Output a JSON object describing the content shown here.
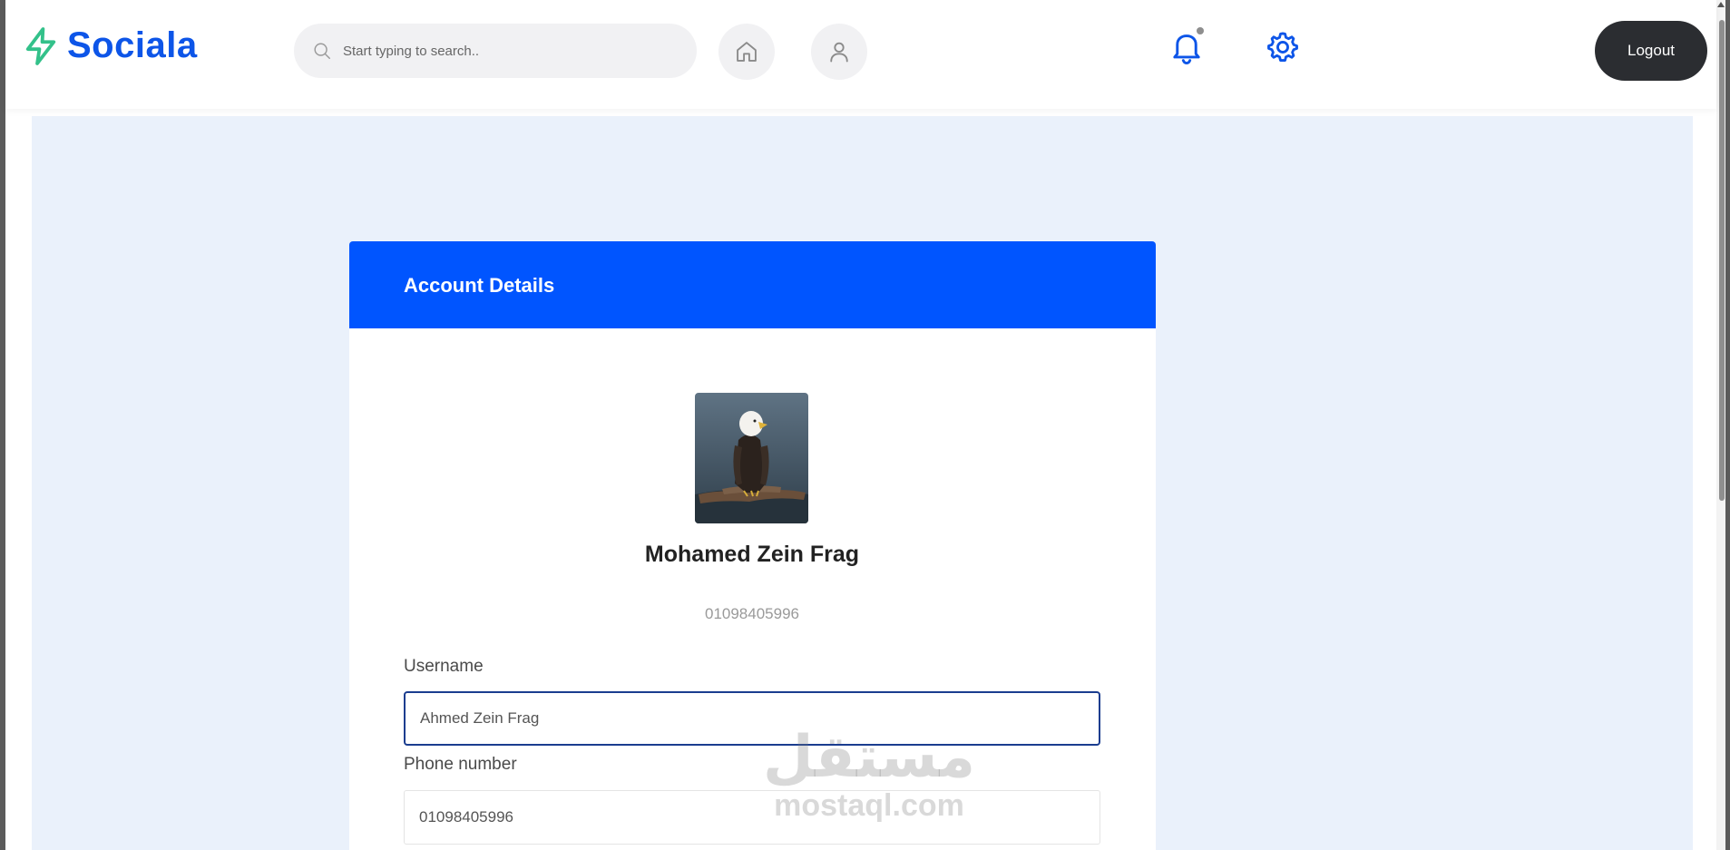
{
  "app": {
    "name": "Sociala",
    "brand_color": "#0d55e8",
    "accent_color": "#33c18a"
  },
  "header": {
    "search": {
      "placeholder": "Start typing to search.."
    },
    "icons": [
      "search-icon",
      "home-icon",
      "user-icon",
      "bell-icon",
      "gear-icon"
    ],
    "logout_label": "Logout"
  },
  "account": {
    "header_title": "Account Details",
    "header_color": "#0055ff",
    "profile": {
      "name": "Mohamed Zein Frag",
      "phone": "01098405996"
    },
    "form": {
      "username_label": "Username",
      "username_value": "Ahmed Zein Frag",
      "phone_label": "Phone number",
      "phone_value": "01098405996"
    }
  },
  "watermark": {
    "arabic": "مستقل",
    "latin": "mostaql.com"
  }
}
